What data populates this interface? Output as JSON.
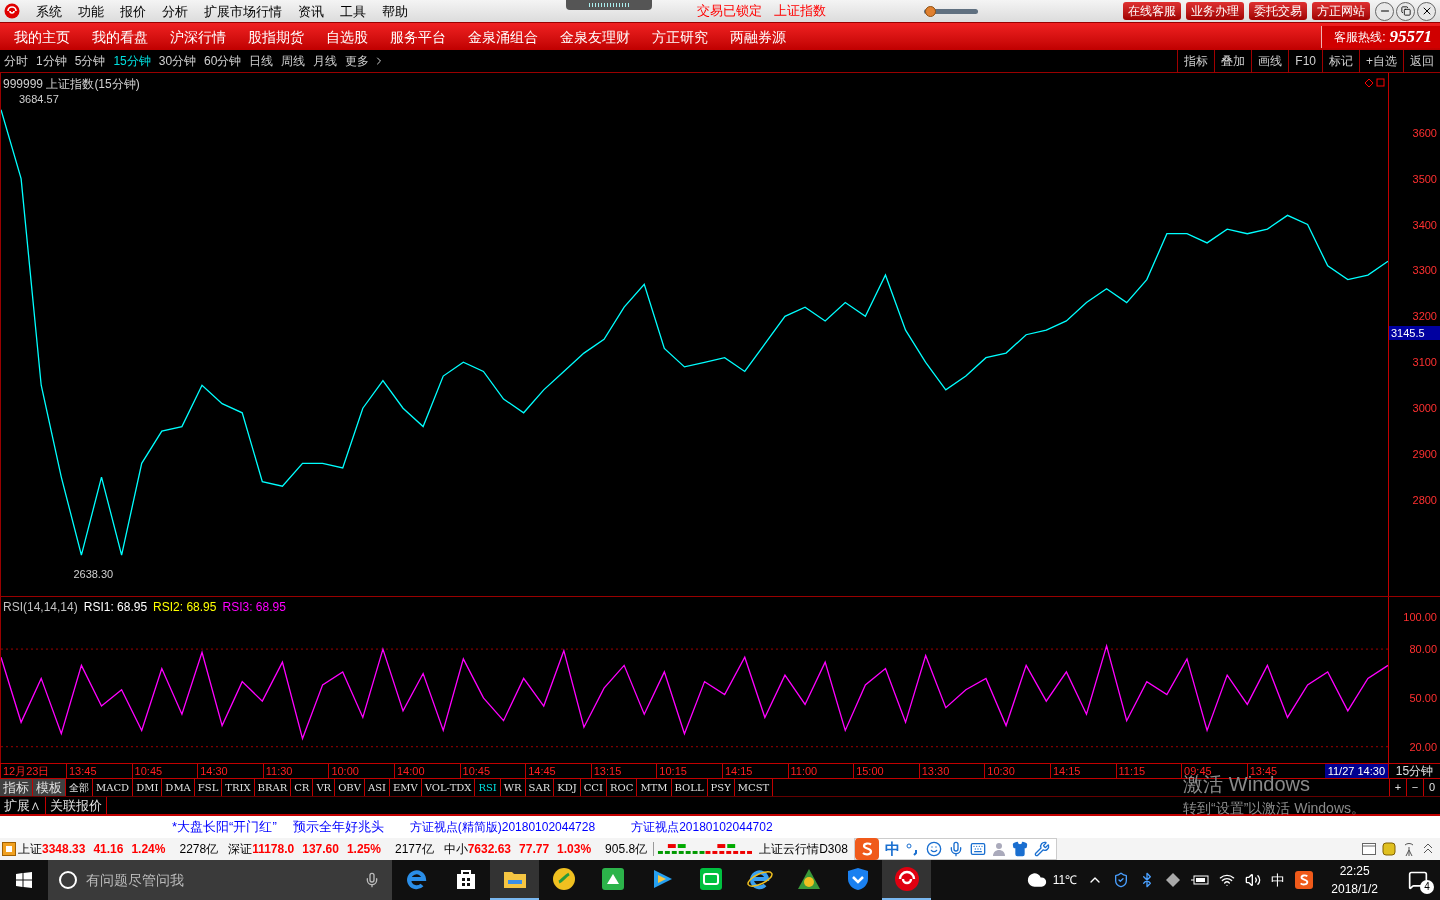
{
  "title_bar": {
    "menus": [
      "系统",
      "功能",
      "报价",
      "分析",
      "扩展市场行情",
      "资讯",
      "工具",
      "帮助"
    ],
    "lock_status": "交易已锁定",
    "index_name": "上证指数",
    "slider": {
      "level": 0.08
    },
    "buttons": [
      "在线客服",
      "业务办理",
      "委托交易",
      "方正网站"
    ]
  },
  "nav": {
    "items": [
      "我的主页",
      "我的看盘",
      "沪深行情",
      "股指期货",
      "自选股",
      "服务平台",
      "金泉涌组合",
      "金泉友理财",
      "方正研究",
      "两融券源"
    ],
    "hotline_label": "客服热线:",
    "hotline_number": "95571"
  },
  "periods": [
    {
      "label": "分时",
      "selected": false
    },
    {
      "label": "1分钟",
      "selected": false
    },
    {
      "label": "5分钟",
      "selected": false
    },
    {
      "label": "15分钟",
      "selected": true
    },
    {
      "label": "30分钟",
      "selected": false
    },
    {
      "label": "60分钟",
      "selected": false
    },
    {
      "label": "日线",
      "selected": false
    },
    {
      "label": "周线",
      "selected": false
    },
    {
      "label": "月线",
      "selected": false
    },
    {
      "label": "更多",
      "selected": false
    }
  ],
  "tools": [
    "指标",
    "叠加",
    "画线",
    "F10",
    "标记",
    "+自选",
    "返回"
  ],
  "main_chart": {
    "title": "999999 上证指数(15分钟)",
    "high_label": "3684.57",
    "low_label": "2638.30",
    "price_marker": "3145.5",
    "chart_data": {
      "type": "line",
      "ylim": [
        2591,
        3730
      ],
      "yticks": [
        2800,
        2900,
        3000,
        3100,
        3200,
        3300,
        3400,
        3500,
        3600
      ],
      "series": [
        {
          "color": "#00ffff",
          "values": [
            3650,
            3500,
            3050,
            2850,
            2680,
            2850,
            2680,
            2880,
            2950,
            2960,
            3050,
            3010,
            2990,
            2840,
            2830,
            2880,
            2880,
            2870,
            3000,
            3060,
            3000,
            2960,
            3070,
            3100,
            3080,
            3020,
            2990,
            3040,
            3080,
            3120,
            3150,
            3220,
            3270,
            3130,
            3090,
            3100,
            3110,
            3080,
            3140,
            3200,
            3220,
            3190,
            3230,
            3200,
            3290,
            3170,
            3100,
            3040,
            3070,
            3110,
            3120,
            3160,
            3170,
            3190,
            3230,
            3260,
            3230,
            3280,
            3380,
            3380,
            3360,
            3390,
            3380,
            3390,
            3420,
            3400,
            3310,
            3280,
            3290,
            3320
          ]
        }
      ]
    }
  },
  "rsi_panel": {
    "legend": [
      {
        "text": "RSI(14,14,14)",
        "color": "#c0c0c0"
      },
      {
        "text": "RSI1: 68.95",
        "color": "#ffffff"
      },
      {
        "text": "RSI2: 68.95",
        "color": "#ffff00"
      },
      {
        "text": "RSI3: 68.95",
        "color": "#ff00ff"
      }
    ],
    "chart_data": {
      "type": "line",
      "ylim": [
        10,
        112
      ],
      "yticks": [
        {
          "value": 20,
          "label": "20.00"
        },
        {
          "value": 50,
          "label": "50.00"
        },
        {
          "value": 80,
          "label": "80.00"
        },
        {
          "value": 100,
          "label": "100.00"
        }
      ],
      "series": [
        {
          "color": "#ff00ff",
          "values": [
            75,
            35,
            62,
            28,
            70,
            45,
            55,
            30,
            68,
            40,
            78,
            33,
            60,
            48,
            72,
            25,
            58,
            66,
            38,
            80,
            42,
            65,
            30,
            74,
            50,
            36,
            62,
            45,
            79,
            32,
            56,
            70,
            40,
            66,
            28,
            60,
            52,
            75,
            38,
            64,
            46,
            72,
            30,
            58,
            68,
            35,
            76,
            44,
            55,
            62,
            33,
            70,
            48,
            66,
            40,
            82,
            36,
            60,
            52,
            74,
            30,
            64,
            46,
            70,
            38,
            58,
            66,
            42,
            62,
            70
          ]
        }
      ]
    }
  },
  "time_axis": [
    "12月23日",
    "13:45",
    "10:45",
    "14:30",
    "11:30",
    "10:00",
    "14:00",
    "10:45",
    "14:45",
    "13:15",
    "10:15",
    "14:15",
    "11:00",
    "15:00",
    "13:30",
    "10:30",
    "14:15",
    "11:15",
    "09:45",
    "13:45"
  ],
  "cursor_time": "11/27 14:30",
  "period_label": "15分钟",
  "indicator_tabs": [
    {
      "label": "指标",
      "selected": false,
      "kind": "gray"
    },
    {
      "label": "模板",
      "selected": false,
      "kind": "gray"
    },
    {
      "label": "全部",
      "selected": false,
      "kind": "plain"
    },
    {
      "label": "MACD",
      "selected": false,
      "kind": "plain"
    },
    {
      "label": "DMI",
      "selected": false,
      "kind": "plain"
    },
    {
      "label": "DMA",
      "selected": false,
      "kind": "plain"
    },
    {
      "label": "FSL",
      "selected": false,
      "kind": "plain"
    },
    {
      "label": "TRIX",
      "selected": false,
      "kind": "plain"
    },
    {
      "label": "BRAR",
      "selected": false,
      "kind": "plain"
    },
    {
      "label": "CR",
      "selected": false,
      "kind": "plain"
    },
    {
      "label": "VR",
      "selected": false,
      "kind": "plain"
    },
    {
      "label": "OBV",
      "selected": false,
      "kind": "plain"
    },
    {
      "label": "ASI",
      "selected": false,
      "kind": "plain"
    },
    {
      "label": "EMV",
      "selected": false,
      "kind": "plain"
    },
    {
      "label": "VOL-TDX",
      "selected": false,
      "kind": "plain"
    },
    {
      "label": "RSI",
      "selected": true,
      "kind": "plain"
    },
    {
      "label": "WR",
      "selected": false,
      "kind": "plain"
    },
    {
      "label": "SAR",
      "selected": false,
      "kind": "plain"
    },
    {
      "label": "KDJ",
      "selected": false,
      "kind": "plain"
    },
    {
      "label": "CCI",
      "selected": false,
      "kind": "plain"
    },
    {
      "label": "ROC",
      "selected": false,
      "kind": "plain"
    },
    {
      "label": "MTM",
      "selected": false,
      "kind": "plain"
    },
    {
      "label": "BOLL",
      "selected": false,
      "kind": "plain"
    },
    {
      "label": "PSY",
      "selected": false,
      "kind": "plain"
    },
    {
      "label": "MCST",
      "selected": false,
      "kind": "plain"
    }
  ],
  "zoom_buttons": [
    "+",
    "−",
    "0"
  ],
  "extra_tabs": [
    "扩展∧",
    "关联报价"
  ],
  "activation": {
    "title": "激活 Windows",
    "subtitle": "转到“设置”以激活 Windows。"
  },
  "news": [
    "*大盘长阳“开门红”",
    "预示全年好兆头",
    "方证视点(精简版)20180102044728",
    "方证视点20180102044702"
  ],
  "quotes": [
    {
      "name": "上证",
      "price": "3348.33",
      "change": "41.16",
      "pct": "1.24%",
      "volume": "2278亿"
    },
    {
      "name": "深证",
      "price": "11178.0",
      "change": "137.60",
      "pct": "1.25%",
      "volume": "2177亿"
    },
    {
      "name": "中小",
      "price": "7632.63",
      "change": "77.77",
      "pct": "1.03%",
      "volume": "905.8亿"
    }
  ],
  "cloud_label": "上证云行情D308",
  "ime_label": "中",
  "taskbar": {
    "search_placeholder": "有问题尽管问我",
    "weather": "11℃",
    "ime": "中",
    "time": "22:25",
    "date": "2018/1/2",
    "notifications": "4"
  }
}
